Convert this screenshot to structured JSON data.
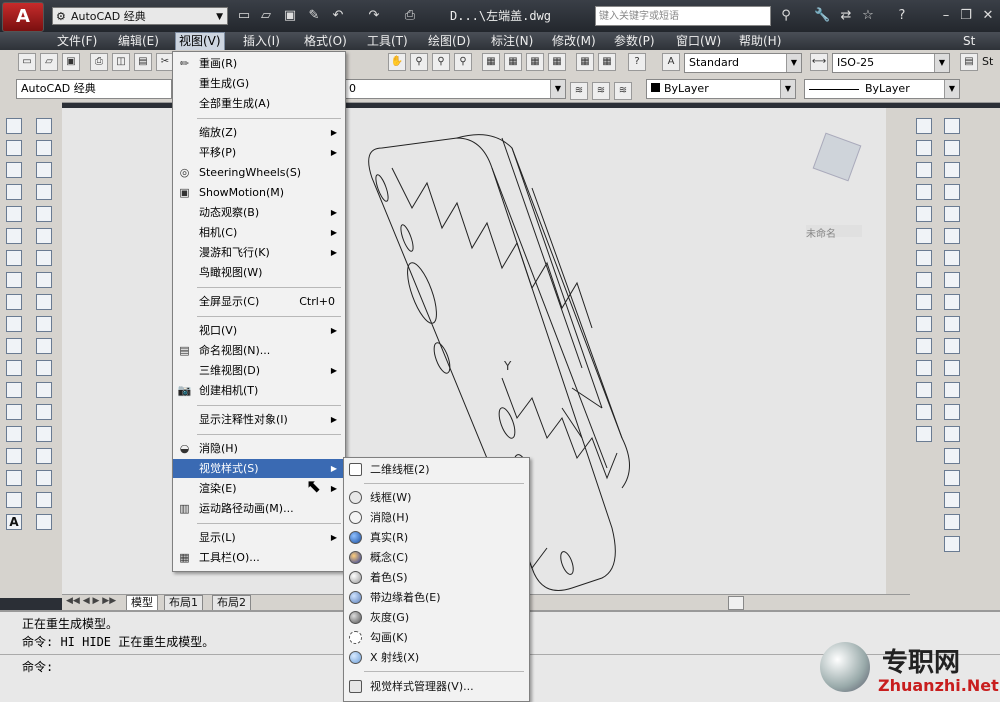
{
  "title_bar": {
    "app_button": "A",
    "workspace": "AutoCAD 经典",
    "doc_title": "D...\\左端盖.dwg",
    "search_placeholder": "键入关键字或短语"
  },
  "menubar": {
    "items": [
      "文件(F)",
      "编辑(E)",
      "视图(V)",
      "插入(I)",
      "格式(O)",
      "工具(T)",
      "绘图(D)",
      "标注(N)",
      "修改(M)",
      "参数(P)",
      "窗口(W)",
      "帮助(H)"
    ],
    "active": "视图(V)",
    "right_label": "St"
  },
  "toolbar": {
    "text_style": "Standard",
    "dim_style": "ISO-25",
    "workspace_combo": "AutoCAD 经典",
    "layer_value": "0",
    "color": "ByLayer",
    "linetype": "ByLayer",
    "st_label": "St"
  },
  "view_menu": {
    "items": [
      {
        "label": "重画(R)",
        "icon": "redraw-icon"
      },
      {
        "label": "重生成(G)"
      },
      {
        "label": "全部重生成(A)"
      },
      {
        "sep": true
      },
      {
        "label": "缩放(Z)",
        "submenu": true
      },
      {
        "label": "平移(P)",
        "submenu": true
      },
      {
        "label": "SteeringWheels(S)",
        "icon": "steeringwheels-icon"
      },
      {
        "label": "ShowMotion(M)",
        "icon": "showmotion-icon"
      },
      {
        "label": "动态观察(B)",
        "submenu": true
      },
      {
        "label": "相机(C)",
        "submenu": true
      },
      {
        "label": "漫游和飞行(K)",
        "submenu": true
      },
      {
        "label": "鸟瞰视图(W)"
      },
      {
        "sep": true
      },
      {
        "label": "全屏显示(C)",
        "shortcut": "Ctrl+0"
      },
      {
        "sep": true
      },
      {
        "label": "视口(V)",
        "submenu": true
      },
      {
        "label": "命名视图(N)...",
        "icon": "named-views-icon"
      },
      {
        "label": "三维视图(D)",
        "submenu": true
      },
      {
        "label": "创建相机(T)",
        "icon": "camera-icon"
      },
      {
        "sep": true
      },
      {
        "label": "显示注释性对象(I)",
        "submenu": true
      },
      {
        "sep": true
      },
      {
        "label": "消隐(H)",
        "icon": "hide-icon"
      },
      {
        "label": "视觉样式(S)",
        "submenu": true,
        "highlight": true
      },
      {
        "label": "渲染(E)",
        "submenu": true
      },
      {
        "label": "运动路径动画(M)...",
        "icon": "motion-path-icon"
      },
      {
        "sep": true
      },
      {
        "label": "显示(L)",
        "submenu": true
      },
      {
        "label": "工具栏(O)...",
        "icon": "toolbar-icon"
      }
    ]
  },
  "visual_styles_menu": {
    "items": [
      {
        "label": "二维线框(2)",
        "icon": "wireframe-2d-icon"
      },
      {
        "sep": true
      },
      {
        "label": "线框(W)",
        "icon": "wireframe-icon"
      },
      {
        "label": "消隐(H)",
        "icon": "hidden-icon"
      },
      {
        "label": "真实(R)",
        "icon": "realistic-icon"
      },
      {
        "label": "概念(C)",
        "icon": "conceptual-icon"
      },
      {
        "label": "着色(S)",
        "icon": "shaded-icon"
      },
      {
        "label": "带边缘着色(E)",
        "icon": "shaded-edges-icon"
      },
      {
        "label": "灰度(G)",
        "icon": "shades-of-gray-icon"
      },
      {
        "label": "勾画(K)",
        "icon": "sketchy-icon"
      },
      {
        "label": "X 射线(X)",
        "icon": "xray-icon"
      },
      {
        "sep": true
      },
      {
        "label": "视觉样式管理器(V)...",
        "icon": "style-manager-icon"
      }
    ]
  },
  "canvas": {
    "ucs_label": "Y",
    "viewcube_label": "未命名"
  },
  "layout_tabs": [
    "模型",
    "布局1",
    "布局2"
  ],
  "command_line": {
    "line1": "正在重生成模型。",
    "line2": "命令: HI HIDE 正在重生成模型。",
    "prompt": "命令:"
  },
  "watermark": {
    "cn": "专职网",
    "en": "Zhuanzhi.Net"
  }
}
